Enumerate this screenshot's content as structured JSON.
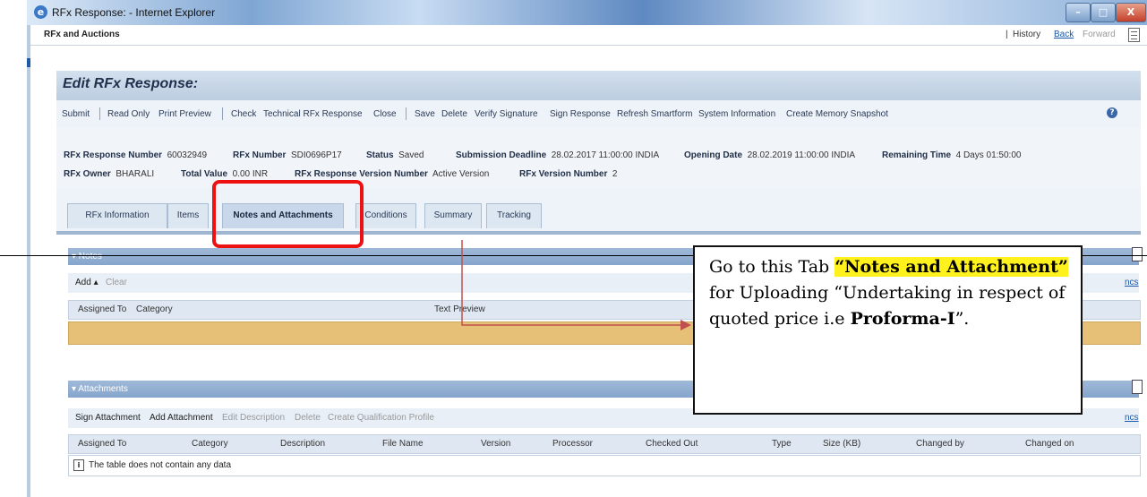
{
  "window": {
    "title": "RFx Response: - Internet Explorer",
    "ie_icon": "e",
    "controls": [
      "–",
      "□",
      "X"
    ]
  },
  "app_bar": {
    "name": "RFx and Auctions",
    "separator": "|",
    "history": "History",
    "back": "Back",
    "forward": "Forward"
  },
  "page": {
    "title": "Edit RFx Response:"
  },
  "toolbar": {
    "group1": [
      "Submit"
    ],
    "group2": [
      "Read Only",
      "Print Preview"
    ],
    "group3": [
      "Check",
      "Technical RFx Response",
      "Close"
    ],
    "group4": [
      "Save",
      "Delete",
      "Verify Signature",
      "Sign Response",
      "Refresh Smartform",
      "System Information",
      "Create Memory Snapshot"
    ],
    "help_icon": "?"
  },
  "info": {
    "response_number_label": "RFx Response Number",
    "response_number": "60032949",
    "rfx_number_label": "RFx Number",
    "rfx_number": "SDI0696P17",
    "status_label": "Status",
    "status": "Saved",
    "deadline_label": "Submission Deadline",
    "deadline": "28.02.2017 11:00:00 INDIA",
    "opening_label": "Opening Date",
    "opening": "28.02.2019 11:00:00 INDIA",
    "remaining_label": "Remaining Time",
    "remaining": "4 Days 01:50:00",
    "owner_label": "RFx Owner",
    "owner": "BHARALI",
    "total_label": "Total Value",
    "total": "0.00 INR",
    "version_label": "RFx Response Version Number",
    "version": "Active Version",
    "rfx_version_label": "RFx Version Number",
    "rfx_version": "2"
  },
  "tabs": [
    "RFx Information",
    "Items",
    "Notes and Attachments",
    "Conditions",
    "Summary",
    "Tracking"
  ],
  "notes": {
    "title": "▾ Notes",
    "add": "Add",
    "clear": "Clear",
    "columns": [
      "Assigned To",
      "Category",
      "Text Preview"
    ],
    "right_link": "ncs"
  },
  "attachments": {
    "title": "▾ Attachments",
    "tools": [
      "Sign Attachment",
      "Add Attachment",
      "Edit Description",
      "Delete",
      "Create Qualification Profile"
    ],
    "columns": [
      "Assigned To",
      "Category",
      "Description",
      "File Name",
      "Version",
      "Processor",
      "Checked Out",
      "Type",
      "Size (KB)",
      "Changed by",
      "Changed on"
    ],
    "empty_icon": "i",
    "empty_text": "The table does not contain any data",
    "right_link": "ncs"
  },
  "callout": {
    "part1": "Go to this Tab ",
    "highlight": "“Notes and Attachment”",
    "part2": " for Uploading “Undertaking in respect of quoted price i.e ",
    "bold": "Proforma-I",
    "part3": "”."
  }
}
